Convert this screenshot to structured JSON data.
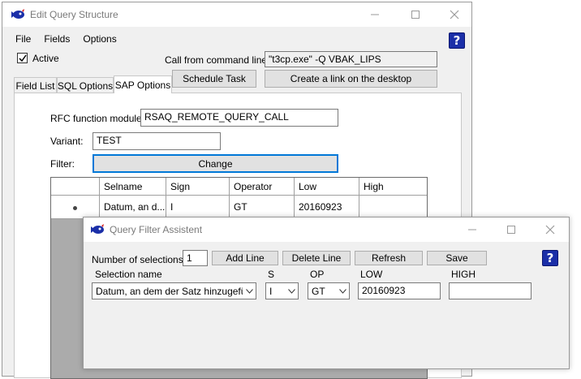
{
  "main_window": {
    "title": "Edit Query Structure",
    "menu": [
      "File",
      "Fields",
      "Options"
    ],
    "help_label": "?",
    "active_label": "Active",
    "active_checked": true,
    "cmd_label": "Call from command line",
    "cmd_value": "\"t3cp.exe\" -Q VBAK_LIPS",
    "schedule_label": "Schedule Task",
    "desktop_link_label": "Create a link on the desktop",
    "tabs": [
      "Field List",
      "SQL Options",
      "SAP Options"
    ],
    "active_tab": "SAP Options",
    "rfc_label": "RFC function module",
    "rfc_value": "RSAQ_REMOTE_QUERY_CALL",
    "variant_label": "Variant:",
    "variant_value": "TEST",
    "filter_label": "Filter:",
    "change_label": "Change",
    "grid": {
      "columns": [
        "",
        "Selname",
        "Sign",
        "Operator",
        "Low",
        "High"
      ],
      "rows": [
        {
          "selname": "Datum, an d...",
          "sign": "I",
          "operator": "GT",
          "low": "20160923",
          "high": ""
        }
      ]
    }
  },
  "filter_window": {
    "title": "Query Filter Assistent",
    "num_label": "Number of selections:",
    "num_value": "1",
    "add_line": "Add Line",
    "delete_line": "Delete Line",
    "refresh": "Refresh",
    "save": "Save",
    "help_label": "?",
    "col_selection": "Selection name",
    "col_s": "S",
    "col_op": "OP",
    "col_low": "LOW",
    "col_high": "HIGH",
    "selection_value": "Datum, an dem der Satz hinzugefügt w",
    "s_value": "I",
    "op_value": "GT",
    "low_value": "20160923",
    "high_value": ""
  },
  "colors": {
    "help_blue": "#1b2fa8",
    "focus_blue": "#0078d7",
    "window_bg": "#f0f0f0",
    "grid_gray": "#ababab"
  },
  "icons": {
    "app": "sap-query-icon",
    "minimize": "minimize-icon",
    "maximize": "maximize-icon",
    "close": "close-icon",
    "dropdown": "chevron-down-icon"
  }
}
